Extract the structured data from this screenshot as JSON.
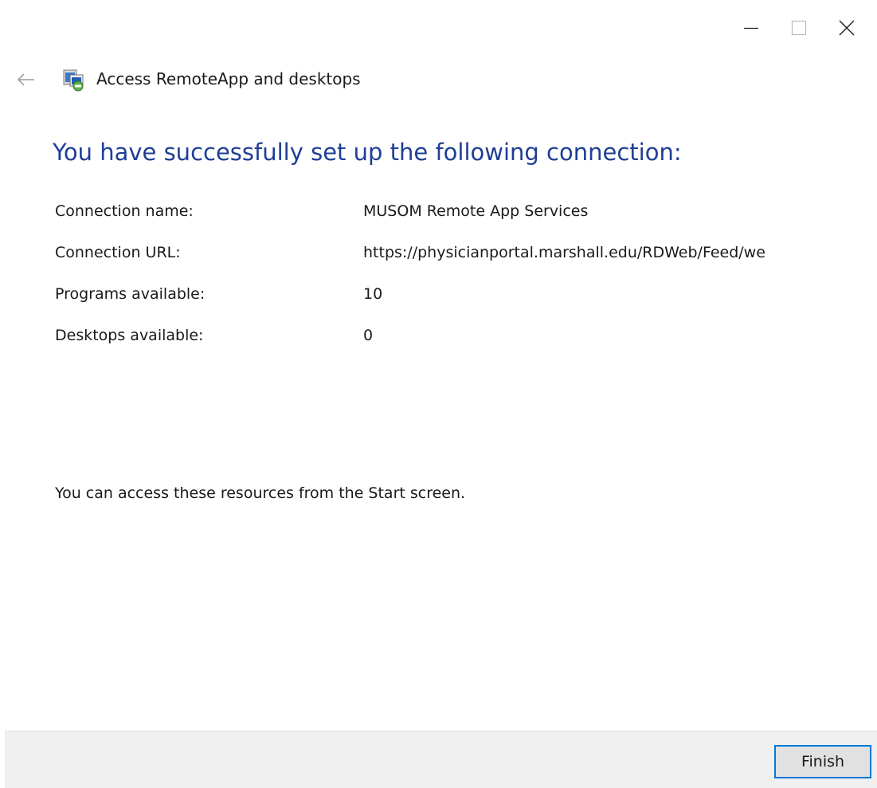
{
  "window": {
    "title": "Access RemoteApp and desktops",
    "icon": "remoteapp-icon",
    "caption_buttons": [
      "minimize-icon",
      "maximize-icon",
      "close-icon"
    ]
  },
  "nav": {
    "back_icon": "back-arrow-icon"
  },
  "main": {
    "heading": "You have successfully set up the following connection:",
    "details": [
      {
        "label": "Connection name:",
        "value": "MUSOM Remote App Services"
      },
      {
        "label": "Connection URL:",
        "value": "https://physicianportal.marshall.edu/RDWeb/Feed/we"
      },
      {
        "label": "Programs available:",
        "value": "10"
      },
      {
        "label": "Desktops available:",
        "value": "0"
      }
    ],
    "note": "You can access these resources from the Start screen."
  },
  "footer": {
    "finish_label": "Finish"
  },
  "colors": {
    "heading": "#1f3f95",
    "footer_bg": "#f0f0f0",
    "button_border": "#0078d7"
  }
}
